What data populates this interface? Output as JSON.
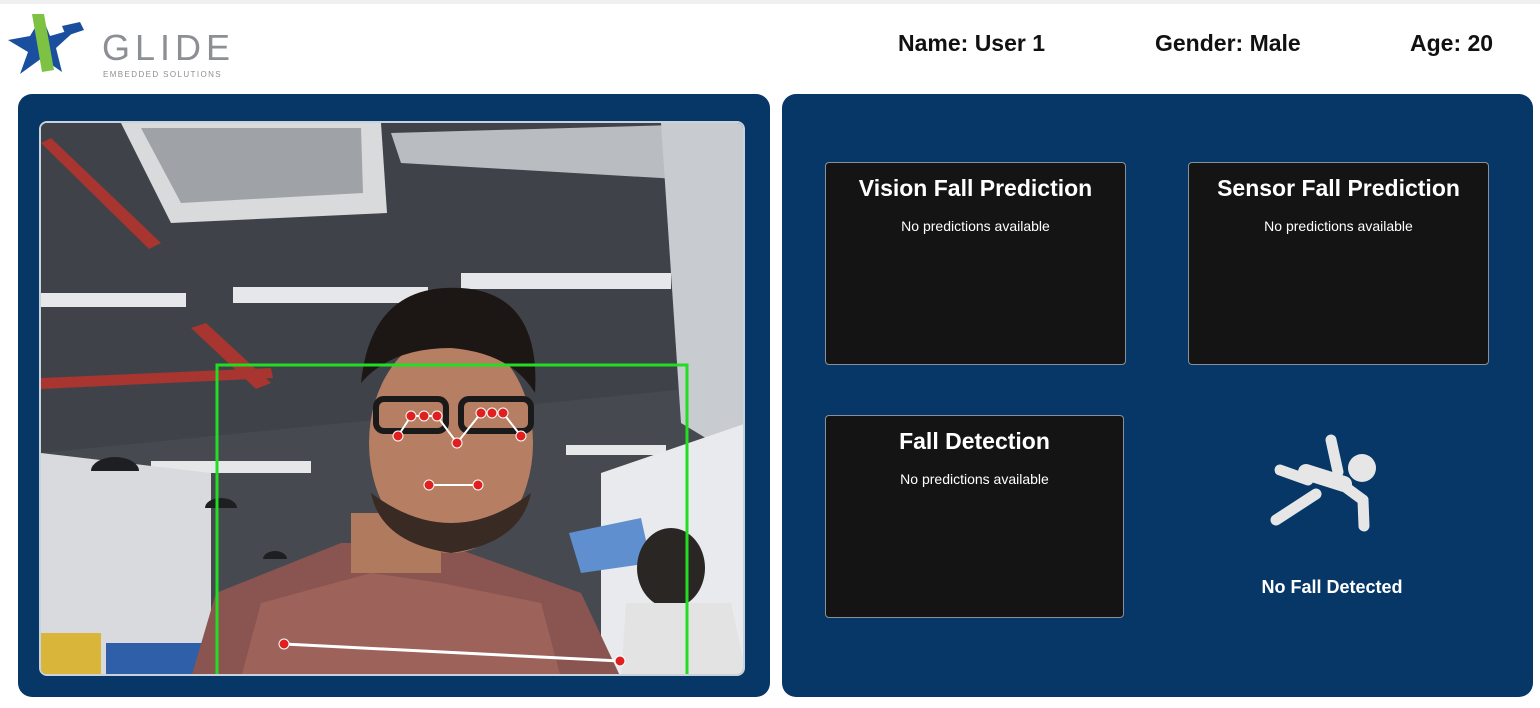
{
  "header": {
    "logo": {
      "name": "GLIDE",
      "tagline": "EMBEDDED SOLUTIONS"
    },
    "user": {
      "name": "Name: User 1",
      "gender": "Gender: Male",
      "age": "Age: 20"
    }
  },
  "camera": {
    "alt": "Live camera feed with face and pose landmarks",
    "detection_box_color": "#22dd22",
    "landmark_color": "#e02020"
  },
  "predictions": {
    "vision": {
      "title": "Vision Fall Prediction",
      "text": "No predictions available"
    },
    "sensor": {
      "title": "Sensor Fall Prediction",
      "text": "No predictions available"
    },
    "detection": {
      "title": "Fall Detection",
      "text": "No predictions available"
    }
  },
  "status": {
    "icon": "person-falling-icon",
    "text": "No Fall Detected"
  },
  "colors": {
    "panel": "#063767",
    "box": "#141414",
    "logo_blue": "#1a4fa0",
    "logo_green": "#7dc242"
  }
}
